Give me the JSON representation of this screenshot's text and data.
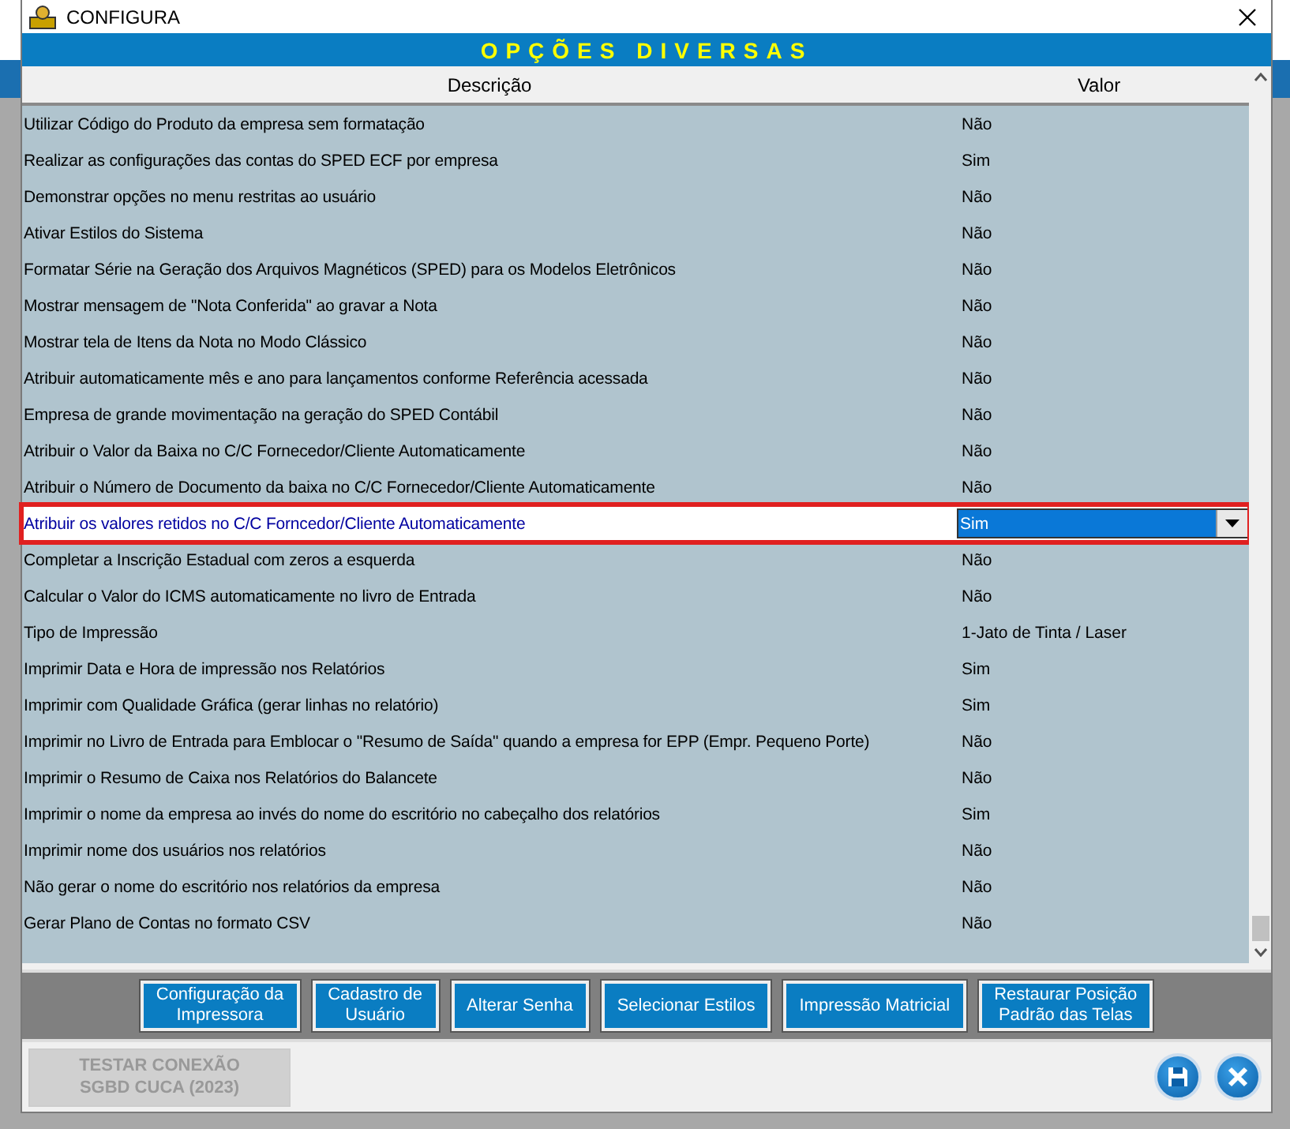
{
  "window": {
    "title": "CONFIGURA"
  },
  "panel_title": "OPÇÕES DIVERSAS",
  "table": {
    "columns": [
      "Descrição",
      "Valor"
    ],
    "rows": [
      {
        "description": "Utilizar Código do Produto da empresa sem formatação",
        "value": "Não",
        "selected": false
      },
      {
        "description": "Realizar as configurações das contas do SPED ECF por empresa",
        "value": "Sim",
        "selected": false
      },
      {
        "description": "Demonstrar opções no menu restritas ao usuário",
        "value": "Não",
        "selected": false
      },
      {
        "description": "Ativar Estilos do Sistema",
        "value": "Não",
        "selected": false
      },
      {
        "description": "Formatar Série na Geração dos Arquivos Magnéticos (SPED) para os Modelos Eletrônicos",
        "value": "Não",
        "selected": false
      },
      {
        "description": "Mostrar mensagem de \"Nota Conferida\" ao gravar a Nota",
        "value": "Não",
        "selected": false
      },
      {
        "description": "Mostrar tela de Itens da Nota no Modo Clássico",
        "value": "Não",
        "selected": false
      },
      {
        "description": "Atribuir automaticamente mês e ano para lançamentos conforme Referência acessada",
        "value": "Não",
        "selected": false
      },
      {
        "description": "Empresa de grande movimentação na geração do SPED Contábil",
        "value": "Não",
        "selected": false
      },
      {
        "description": "Atribuir o Valor da Baixa no C/C Fornecedor/Cliente Automaticamente",
        "value": "Não",
        "selected": false
      },
      {
        "description": "Atribuir o Número de Documento da baixa no C/C Fornecedor/Cliente Automaticamente",
        "value": "Não",
        "selected": false
      },
      {
        "description": "Atribuir os valores retidos no C/C Forncedor/Cliente Automaticamente",
        "value": "Sim",
        "selected": true
      },
      {
        "description": "Completar a Inscrição Estadual com zeros a esquerda",
        "value": "Não",
        "selected": false
      },
      {
        "description": "Calcular o Valor do ICMS automaticamente no livro de Entrada",
        "value": "Não",
        "selected": false
      },
      {
        "description": "Tipo de Impressão",
        "value": "1-Jato de Tinta / Laser",
        "selected": false
      },
      {
        "description": "Imprimir Data e Hora de impressão nos Relatórios",
        "value": "Sim",
        "selected": false
      },
      {
        "description": "Imprimir com Qualidade Gráfica (gerar linhas no relatório)",
        "value": "Sim",
        "selected": false
      },
      {
        "description": "Imprimir no Livro de Entrada para Emblocar o \"Resumo de Saída\" quando a empresa for EPP (Empr. Pequeno Porte)",
        "value": "Não",
        "selected": false
      },
      {
        "description": "Imprimir o Resumo de Caixa nos Relatórios do Balancete",
        "value": "Não",
        "selected": false
      },
      {
        "description": "Imprimir o nome da empresa ao invés do nome do escritório no cabeçalho dos relatórios",
        "value": "Sim",
        "selected": false
      },
      {
        "description": "Imprimir nome dos usuários nos relatórios",
        "value": "Não",
        "selected": false
      },
      {
        "description": "Não gerar o nome do escritório nos relatórios da empresa",
        "value": "Não",
        "selected": false
      },
      {
        "description": "Gerar Plano de Contas no formato CSV",
        "value": "Não",
        "selected": false
      }
    ]
  },
  "buttons": [
    {
      "lines": [
        "Configuração da",
        "Impressora"
      ]
    },
    {
      "lines": [
        "Cadastro de",
        "Usuário"
      ]
    },
    {
      "lines": [
        "Alterar Senha"
      ]
    },
    {
      "lines": [
        "Selecionar Estilos"
      ]
    },
    {
      "lines": [
        "Impressão Matricial"
      ]
    },
    {
      "lines": [
        "Restaurar Posição",
        "Padrão das Telas"
      ]
    }
  ],
  "test_button": {
    "lines": [
      "TESTAR CONEXÃO",
      "SGBD CUCA (2023)"
    ],
    "disabled": true
  }
}
